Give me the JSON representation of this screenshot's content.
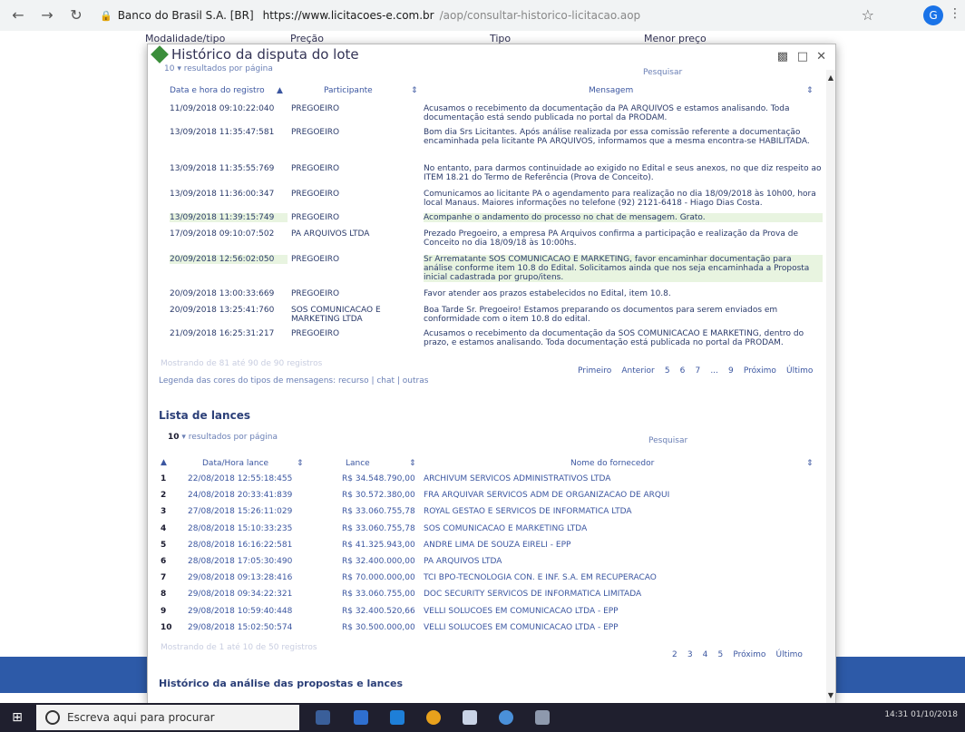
{
  "browser": {
    "url_prefix": "Banco do Brasil S.A. [BR]",
    "url_host": "https://www.licitacoes-e.com.br",
    "url_path": "/aop/consultar-historico-licitacao.aop",
    "profile_initial": "G"
  },
  "background_page": {
    "headers": [
      "Modalidade/tipo",
      "Preção",
      "Tipo",
      "Menor preço"
    ]
  },
  "modal": {
    "title": "Histórico da disputa do lote",
    "results_per_page_value": "10",
    "results_per_page_label": "resultados por página",
    "search_link": "Pesquisar",
    "columns": [
      "Data e hora do registro",
      "Participante",
      "Mensagem"
    ],
    "messages": [
      {
        "date": "11/09/2018 09:10:22:040",
        "participant": "PREGOEIRO",
        "message": "Acusamos o recebimento da documentação da PA ARQUIVOS e estamos analisando. Toda documentação está sendo publicada no portal da PRODAM.",
        "highlight": false
      },
      {
        "date": "13/09/2018 11:35:47:581",
        "participant": "PREGOEIRO",
        "message": "Bom dia Srs Licitantes. Após análise realizada por essa comissão referente a documentação encaminhada pela licitante PA ARQUIVOS, informamos que a mesma encontra-se HABILITADA.",
        "highlight": false
      },
      {
        "date": "13/09/2018 11:35:55:769",
        "participant": "PREGOEIRO",
        "message": "No entanto, para darmos continuidade ao exigido no Edital e seus anexos, no que diz respeito ao ITEM 18.21 do Termo de Referência (Prova de Conceito).",
        "highlight": false
      },
      {
        "date": "13/09/2018 11:36:00:347",
        "participant": "PREGOEIRO",
        "message": "Comunicamos ao licitante PA o agendamento para realização no dia 18/09/2018 às 10h00, hora local Manaus. Maiores informações no telefone (92) 2121-6418 - Hiago Dias Costa.",
        "highlight": false
      },
      {
        "date": "13/09/2018 11:39:15:749",
        "participant": "PREGOEIRO",
        "message": "Acompanhe o andamento do processo no chat de mensagem. Grato.",
        "highlight": true
      },
      {
        "date": "17/09/2018 09:10:07:502",
        "participant": "PA ARQUIVOS LTDA",
        "message": "Prezado Pregoeiro, a empresa PA Arquivos confirma a participação e realização da Prova de Conceito no dia 18/09/18 às 10:00hs.",
        "highlight": false
      },
      {
        "date": "20/09/2018 12:56:02:050",
        "participant": "PREGOEIRO",
        "message": "Sr Arrematante SOS COMUNICACAO E MARKETING, favor encaminhar documentação para análise conforme item 10.8 do Edital. Solicitamos ainda que nos seja encaminhada a Proposta inicial cadastrada por grupo/itens.",
        "highlight": true
      },
      {
        "date": "20/09/2018 13:00:33:669",
        "participant": "PREGOEIRO",
        "message": "Favor atender aos prazos estabelecidos no Edital, item 10.8.",
        "highlight": false
      },
      {
        "date": "20/09/2018 13:25:41:760",
        "participant": "SOS COMUNICACAO E MARKETING LTDA",
        "message": "Boa Tarde Sr. Pregoeiro! Estamos preparando os documentos para serem enviados em conformidade com o item 10.8 do edital.",
        "highlight": false
      },
      {
        "date": "21/09/2018 16:25:31:217",
        "participant": "PREGOEIRO",
        "message": "Acusamos o recebimento da documentação da SOS COMUNICACAO E MARKETING, dentro do prazo, e estamos analisando. Toda documentação está publicada no portal da PRODAM.",
        "highlight": false
      }
    ],
    "pager_label": "Mostrando de 81 até 90 de 90 registros",
    "pager": [
      "Primeiro",
      "Anterior",
      "5",
      "6",
      "7",
      "...",
      "9",
      "Próximo",
      "Último"
    ],
    "legend_label": "Legenda das cores do tipos de mensagens: recurso | chat | outras",
    "bids_section": {
      "title": "Lista de lances",
      "results_per_page_value": "10",
      "results_per_page_label": "resultados por página",
      "search_link": "Pesquisar",
      "columns": [
        "Data/Hora lance",
        "Lance",
        "Nome do fornecedor"
      ],
      "rows": [
        {
          "n": "1",
          "date": "22/08/2018 12:55:18:455",
          "value": "R$ 34.548.790,00",
          "supplier": "ARCHIVUM SERVICOS ADMINISTRATIVOS LTDA"
        },
        {
          "n": "2",
          "date": "24/08/2018 20:33:41:839",
          "value": "R$ 30.572.380,00",
          "supplier": "FRA ARQUIVAR SERVICOS ADM DE ORGANIZACAO DE ARQUI"
        },
        {
          "n": "3",
          "date": "27/08/2018 15:26:11:029",
          "value": "R$ 33.060.755,78",
          "supplier": "ROYAL GESTAO E SERVICOS DE INFORMATICA LTDA"
        },
        {
          "n": "4",
          "date": "28/08/2018 15:10:33:235",
          "value": "R$ 33.060.755,78",
          "supplier": "SOS COMUNICACAO E MARKETING LTDA"
        },
        {
          "n": "5",
          "date": "28/08/2018 16:16:22:581",
          "value": "R$ 41.325.943,00",
          "supplier": "ANDRE LIMA DE SOUZA EIRELI - EPP"
        },
        {
          "n": "6",
          "date": "28/08/2018 17:05:30:490",
          "value": "R$ 32.400.000,00",
          "supplier": "PA ARQUIVOS LTDA"
        },
        {
          "n": "7",
          "date": "29/08/2018 09:13:28:416",
          "value": "R$ 70.000.000,00",
          "supplier": "TCI BPO-TECNOLOGIA CON. E INF. S.A. EM RECUPERACAO"
        },
        {
          "n": "8",
          "date": "29/08/2018 09:34:22:321",
          "value": "R$ 33.060.755,00",
          "supplier": "DOC SECURITY SERVICOS DE INFORMATICA LIMITADA"
        },
        {
          "n": "9",
          "date": "29/08/2018 10:59:40:448",
          "value": "R$ 32.400.520,66",
          "supplier": "VELLI SOLUCOES EM COMUNICACAO LTDA - EPP"
        },
        {
          "n": "10",
          "date": "29/08/2018 15:02:50:574",
          "value": "R$ 30.500.000,00",
          "supplier": "VELLI SOLUCOES EM COMUNICACAO LTDA - EPP"
        }
      ],
      "pager_label": "Mostrando de 1 até 10 de 50 registros",
      "pager": [
        "2",
        "3",
        "4",
        "5",
        "Próximo",
        "Último"
      ]
    },
    "analysis_title": "Histórico da análise das propostas e lances"
  },
  "taskbar": {
    "search_placeholder": "Escreva aqui para procurar",
    "time": "14:31",
    "date": "01/10/2018"
  }
}
